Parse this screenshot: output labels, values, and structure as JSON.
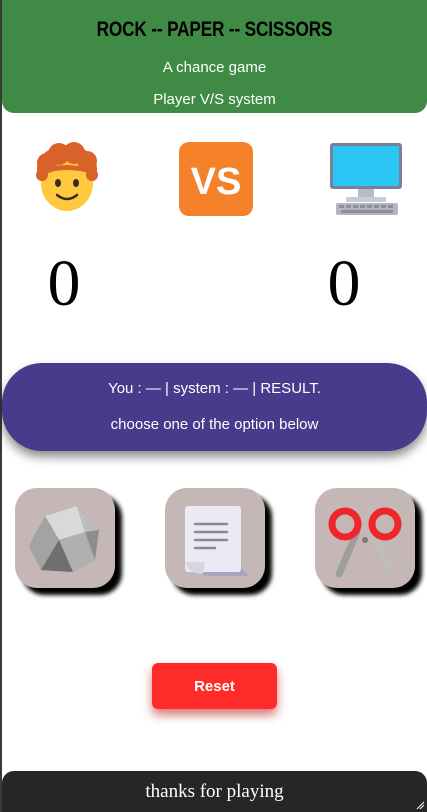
{
  "header": {
    "title": "ROCK -- PAPER -- SCISSORS",
    "subtitle": "A chance game",
    "mode": "Player V/S system"
  },
  "scoreboard": {
    "player_icon": "person-icon",
    "vs_icon": "vs-badge-icon",
    "system_icon": "computer-icon",
    "player_score": "0",
    "system_score": "0"
  },
  "message": {
    "status_line": "You : — | system : — | RESULT.",
    "hint": "choose one of the option below"
  },
  "choices": [
    {
      "name": "rock",
      "icon": "rock-icon"
    },
    {
      "name": "paper",
      "icon": "paper-icon"
    },
    {
      "name": "scissors",
      "icon": "scissors-icon"
    }
  ],
  "controls": {
    "reset_label": "Reset"
  },
  "footer": {
    "text": "thanks for playing"
  },
  "colors": {
    "header_bg": "#3f8a44",
    "message_bg": "#473c8b",
    "reset_bg": "#ff2a2a",
    "choice_bg": "#c5b7b6",
    "footer_bg": "#262626"
  }
}
